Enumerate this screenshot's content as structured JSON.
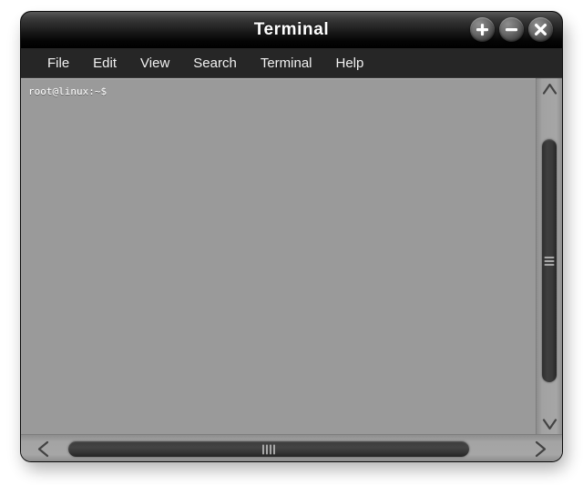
{
  "window": {
    "title": "Terminal",
    "controls": [
      {
        "name": "maximize",
        "glyph": "+"
      },
      {
        "name": "minimize",
        "glyph": "−"
      },
      {
        "name": "close",
        "glyph": "×"
      }
    ]
  },
  "menubar": {
    "items": [
      {
        "label": "File"
      },
      {
        "label": "Edit"
      },
      {
        "label": "View"
      },
      {
        "label": "Search"
      },
      {
        "label": "Terminal"
      },
      {
        "label": "Help"
      }
    ]
  },
  "terminal": {
    "lines": [
      "root@linux:~$"
    ],
    "prompt": "root@linux:~$",
    "background_color": "#9a9a9a",
    "text_color": "#ffffff"
  },
  "scrollbars": {
    "vertical": {
      "up_arrow": "∧",
      "down_arrow": "∨",
      "grip_lines": 3
    },
    "horizontal": {
      "left_arrow": "<",
      "right_arrow": ">",
      "grip_lines": 4
    }
  },
  "colors": {
    "titlebar_top": "#585858",
    "titlebar_bottom": "#000000",
    "menubar": "#262626",
    "terminal_bg": "#9a9a9a",
    "scrollbar_track": "#a4a4a4",
    "scrollbar_thumb": "#383838",
    "page_bg": "#ffffff"
  }
}
